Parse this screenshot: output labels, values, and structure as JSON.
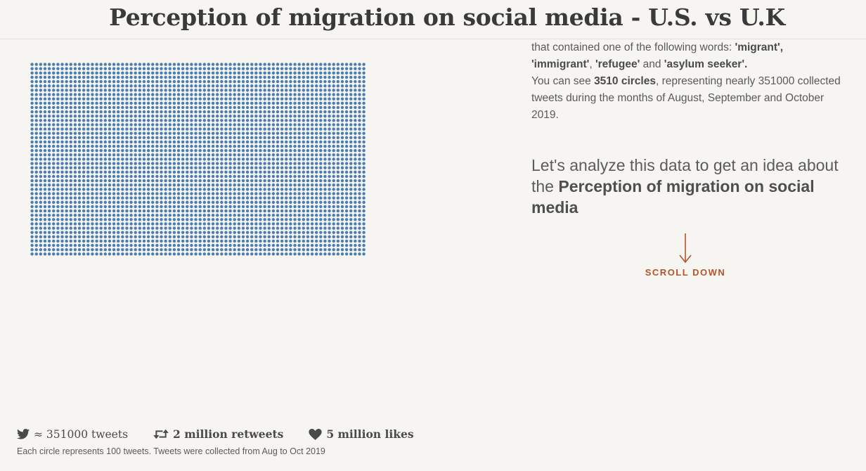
{
  "header": {
    "title": "Perception of migration on social media - U.S. vs U.K"
  },
  "intro": {
    "line1_prefix": "that contained one of the following words: ",
    "word1": "'migrant',",
    "word2": "'immigrant'",
    "sep1": ", ",
    "word3": "'refugee'",
    "sep2": " and ",
    "word4": "'asylum seeker'.",
    "line3_prefix": "You can see ",
    "circles_count": "3510 circles",
    "line3_suffix": ", representing nearly 351000 collected tweets during the months of August, September and October 2019."
  },
  "lead": {
    "prefix": "Let's analyze this data to get an idea about the ",
    "bold": "Perception of migration on social media"
  },
  "scroll": {
    "label": "SCROLL DOWN"
  },
  "stats": {
    "tweets": "≈ 351000 tweets",
    "retweets": "2 million retweets",
    "likes": "5 million likes"
  },
  "note": "Each circle represents 100 tweets. Tweets were collected from Aug to Oct 2019",
  "dot_grid": {
    "total_circles": 3510,
    "columns": 78,
    "dot_color": "#4a7db0"
  },
  "colors": {
    "accent": "#b2552b",
    "dot": "#4a7db0",
    "background": "#f6f5f1"
  },
  "icons": {
    "twitter": "twitter-icon",
    "retweet": "retweet-icon",
    "heart": "heart-icon",
    "arrow": "arrow-down-icon"
  }
}
